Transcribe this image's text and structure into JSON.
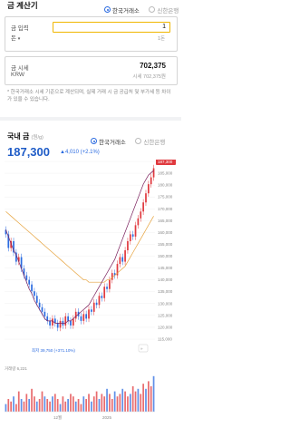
{
  "header": {
    "title": "금 계산기",
    "source_selected": "한국거래소",
    "source_other": "신한은행"
  },
  "calc": {
    "unit_label": "금 입력",
    "unit_sub": "돈",
    "input_value": "1",
    "input_unit": "1돈"
  },
  "price": {
    "label": "금 시세",
    "currency": "KRW",
    "value": "702,375",
    "sub": "시세 702,375원"
  },
  "note": "* 한국거래소 시세 기준으로 계산되며, 실제 거래 시 금 공급처 및 부가세 등 차이가 있을 수 있습니다.",
  "market": {
    "title": "국내 금",
    "unit": "(원/g)",
    "source_selected": "한국거래소",
    "source_other": "신한은행",
    "price": "187,300",
    "change": "▲4,010 (+2.1%)"
  },
  "chart_data": {
    "type": "candlestick",
    "y_ticks": [
      "187,300",
      "185,000",
      "180,000",
      "175,000",
      "170,000",
      "165,000",
      "160,000",
      "155,000",
      "150,000",
      "145,000",
      "140,000",
      "135,000",
      "130,000",
      "125,000",
      "120,000",
      "115,000"
    ],
    "min_label": "최저 39,750 (+371.10%)",
    "volume_label": "거래량 6,221",
    "x_labels": [
      "12월",
      "2025"
    ],
    "close_series": [
      158,
      152,
      155,
      150,
      146,
      148,
      143,
      140,
      138,
      136,
      133,
      131,
      128,
      126,
      124,
      122,
      120,
      118,
      121,
      119,
      117,
      120,
      118,
      122,
      120,
      118,
      121,
      124,
      122,
      120,
      123,
      121,
      125,
      124,
      128,
      127,
      131,
      130,
      135,
      134,
      138,
      141,
      140,
      145,
      148,
      146,
      151,
      155,
      158,
      157,
      162,
      165,
      168,
      172,
      176,
      180,
      183,
      187
    ],
    "ma_short": [
      160,
      157,
      154,
      151,
      149,
      146,
      143,
      140,
      137,
      134,
      132,
      129,
      127,
      125,
      123,
      121,
      120,
      120,
      120,
      119,
      119,
      119,
      119,
      119,
      120,
      120,
      121,
      122,
      123,
      124,
      125,
      126,
      127,
      129,
      131,
      133,
      135,
      137,
      139,
      141,
      143,
      145,
      147,
      150,
      153,
      156,
      159,
      162,
      165,
      168,
      171,
      174,
      177,
      180,
      182,
      184,
      185,
      186
    ],
    "ma_long": [
      168,
      167,
      166,
      165,
      164,
      163,
      162,
      161,
      160,
      159,
      158,
      157,
      156,
      155,
      154,
      153,
      152,
      151,
      150,
      149,
      148,
      147,
      146,
      145,
      144,
      143,
      142,
      141,
      140,
      139,
      138,
      138,
      137,
      137,
      137,
      137,
      137,
      137,
      137,
      138,
      138,
      139,
      140,
      141,
      142,
      143,
      144,
      146,
      148,
      150,
      152,
      154,
      156,
      158,
      160,
      162,
      164,
      166
    ],
    "volume": [
      3,
      5,
      4,
      6,
      3,
      8,
      5,
      4,
      7,
      5,
      9,
      6,
      4,
      5,
      8,
      6,
      5,
      4,
      6,
      7,
      5,
      3,
      6,
      4,
      5,
      7,
      6,
      4,
      5,
      3,
      6,
      5,
      7,
      4,
      6,
      8,
      5,
      7,
      6,
      9,
      7,
      5,
      8,
      6,
      7,
      9,
      8,
      6,
      7,
      10,
      8,
      9,
      7,
      11,
      9,
      12,
      10,
      14
    ],
    "colors": {
      "up": "#e0393e",
      "down": "#2b6be0",
      "ma_short": "#e0393e",
      "ma_long": "#e6a23c",
      "ma_mid": "#7a1f5c"
    }
  }
}
